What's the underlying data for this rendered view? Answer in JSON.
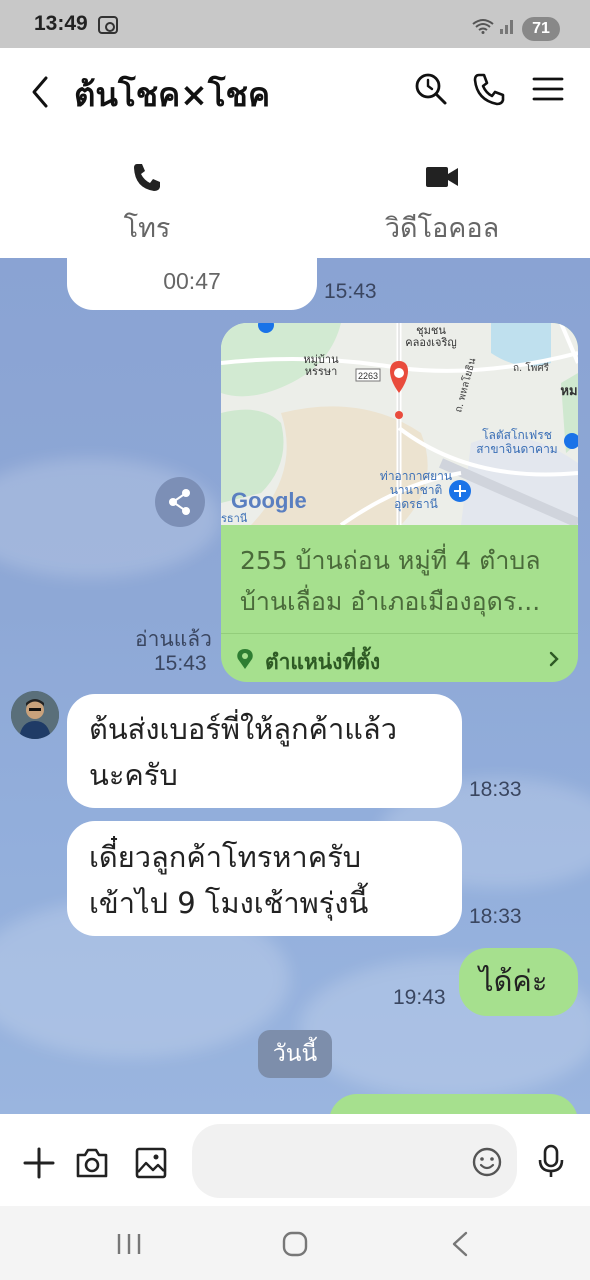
{
  "status_bar": {
    "time": "13:49",
    "battery": "71"
  },
  "header": {
    "title": "ต้นโชค×โชค",
    "icons": [
      "back-icon",
      "search-icon",
      "phone-icon",
      "menu-icon"
    ]
  },
  "call_strip": {
    "voice_label": "โทร",
    "video_label": "วิดีโอคอล"
  },
  "messages": {
    "call_duration": "00:47",
    "call_time": "15:43",
    "location": {
      "address": "255 บ้านถ่อน หมู่ที่ 4 ตำบล บ้านเลื่อม อำเภอเมืองอุดร...",
      "footer_label": "ตำแหน่งที่ตั้ง",
      "read_label": "อ่านแล้ว",
      "time": "15:43",
      "map": {
        "labels": [
          "หมู่บ้าน",
          "หรรษา",
          "ชุมชน",
          "คลองเจริญ",
          "ถ. โพศรี",
          "ถ. พหลโยธิน",
          "โลตัสโกเฟรช",
          "สาขาจินดาคาม",
          "ท่าอากาศยาน",
          "นานาชาติ",
          "อุดรธานี",
          "2263",
          "หม",
          "รธานี"
        ],
        "google_logo": "Google"
      }
    },
    "incoming_1": {
      "text_line1": "ต้นส่งเบอร์พี่ให้ลูกค้าแล้ว",
      "text_line2": "นะครับ",
      "time": "18:33"
    },
    "incoming_2": {
      "text_line1": "เดี๋ยวลูกค้าโทรหาครับ",
      "text_line2": "เข้าไป 9 โมงเช้าพรุ่งนี้",
      "time": "18:33"
    },
    "outgoing_1": {
      "text": "ได้ค่ะ",
      "time": "19:43"
    },
    "date_separator": "วันนี้"
  },
  "input_bar": {
    "placeholder": "",
    "icons": [
      "plus-icon",
      "camera-icon",
      "image-icon",
      "emoji-icon",
      "mic-icon"
    ]
  },
  "colors": {
    "chat_bg": "#8ea8d6",
    "bubble_green": "#a6e08e",
    "bubble_white": "#ffffff",
    "map_pin": "#e94b3c"
  }
}
